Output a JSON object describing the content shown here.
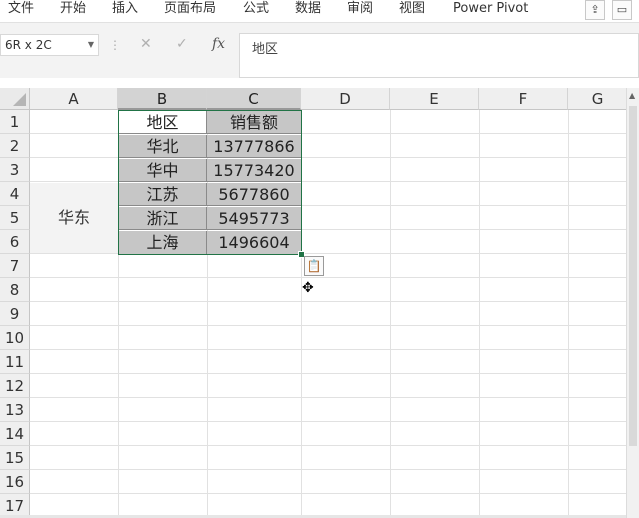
{
  "ribbon": {
    "tabs": [
      "文件",
      "开始",
      "插入",
      "页面布局",
      "公式",
      "数据",
      "审阅",
      "视图",
      "Power Pivot"
    ],
    "share_icon": "share-icon",
    "comment_icon": "comment-icon"
  },
  "formula_bar": {
    "name_box": "6R x 2C",
    "cancel_glyph": "✕",
    "enter_glyph": "✓",
    "fx_label": "fx",
    "content": "地区"
  },
  "sheet": {
    "columns": [
      "A",
      "B",
      "C",
      "D",
      "E",
      "F",
      "G"
    ],
    "rows": [
      "1",
      "2",
      "3",
      "4",
      "5",
      "6",
      "7",
      "8",
      "9",
      "10",
      "11",
      "12",
      "13",
      "14",
      "15",
      "16",
      "17"
    ],
    "merged_a4_a6": "华东",
    "table": [
      {
        "region": "地区",
        "sales": "销售额"
      },
      {
        "region": "华北",
        "sales": "13777866"
      },
      {
        "region": "华中",
        "sales": "15773420"
      },
      {
        "region": "江苏",
        "sales": "5677860"
      },
      {
        "region": "浙江",
        "sales": "5495773"
      },
      {
        "region": "上海",
        "sales": "1496604"
      }
    ]
  },
  "colors": {
    "selection_border": "#217346",
    "data_fill": "#c6c6c6",
    "merged_fill": "#f3f3f3"
  }
}
